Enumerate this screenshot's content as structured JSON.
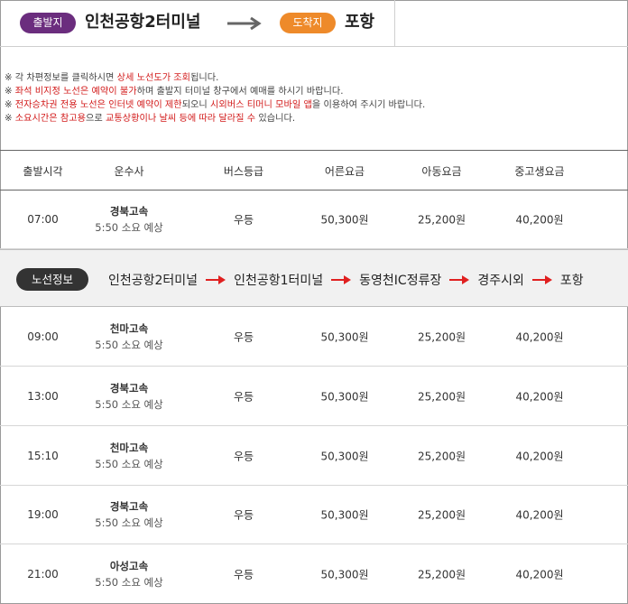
{
  "header": {
    "departure_badge": "출발지",
    "departure": "인천공항2터미널",
    "arrival_badge": "도착지",
    "arrival": "포항"
  },
  "notices": [
    [
      {
        "t": "※ 각 차편정보를 클릭하시면 ",
        "red": false
      },
      {
        "t": "상세 노선도가 조회",
        "red": true
      },
      {
        "t": "됩니다.",
        "red": false
      }
    ],
    [
      {
        "t": "※ ",
        "red": false
      },
      {
        "t": "좌석 비지정 노선은 예약이 불가",
        "red": true
      },
      {
        "t": "하며 출발지 터미널 창구에서 예매를 하시기 바랍니다.",
        "red": false
      }
    ],
    [
      {
        "t": "※ ",
        "red": false
      },
      {
        "t": "전자승차권 전용 노선은 인터넷 예약이 제한",
        "red": true
      },
      {
        "t": "되오니 ",
        "red": false
      },
      {
        "t": "시외버스 티머니 모바일 앱",
        "red": true
      },
      {
        "t": "을 이용하여 주시기 바랍니다.",
        "red": false
      }
    ],
    [
      {
        "t": "※ ",
        "red": false
      },
      {
        "t": "소요시간은 참고용",
        "red": true
      },
      {
        "t": "으로 ",
        "red": false
      },
      {
        "t": "교통상황이나 날씨 등에 따라 달라질 수",
        "red": true
      },
      {
        "t": " 있습니다.",
        "red": false
      }
    ]
  ],
  "table": {
    "headers": [
      "출발시각",
      "운수사",
      "버스등급",
      "어른요금",
      "아동요금",
      "중고생요금"
    ],
    "rows": [
      {
        "time": "07:00",
        "company": "경북고속",
        "duration": "5:50 소요 예상",
        "grade": "우등",
        "adult": "50,300원",
        "child": "25,200원",
        "youth": "40,200원"
      },
      {
        "time": "09:00",
        "company": "천마고속",
        "duration": "5:50 소요 예상",
        "grade": "우등",
        "adult": "50,300원",
        "child": "25,200원",
        "youth": "40,200원"
      },
      {
        "time": "13:00",
        "company": "경북고속",
        "duration": "5:50 소요 예상",
        "grade": "우등",
        "adult": "50,300원",
        "child": "25,200원",
        "youth": "40,200원"
      },
      {
        "time": "15:10",
        "company": "천마고속",
        "duration": "5:50 소요 예상",
        "grade": "우등",
        "adult": "50,300원",
        "child": "25,200원",
        "youth": "40,200원"
      },
      {
        "time": "19:00",
        "company": "경북고속",
        "duration": "5:50 소요 예상",
        "grade": "우등",
        "adult": "50,300원",
        "child": "25,200원",
        "youth": "40,200원"
      },
      {
        "time": "21:00",
        "company": "아성고속",
        "duration": "5:50 소요 예상",
        "grade": "우등",
        "adult": "50,300원",
        "child": "25,200원",
        "youth": "40,200원"
      }
    ]
  },
  "route_info": {
    "badge": "노선정보",
    "stops": [
      "인천공항2터미널",
      "인천공항1터미널",
      "동영천IC정류장",
      "경주시외",
      "포항"
    ]
  },
  "colors": {
    "departure_badge": "#6b2d7e",
    "arrival_badge": "#ee8a2a",
    "notice_highlight": "#d21a1a",
    "route_arrow": "#e02020"
  }
}
